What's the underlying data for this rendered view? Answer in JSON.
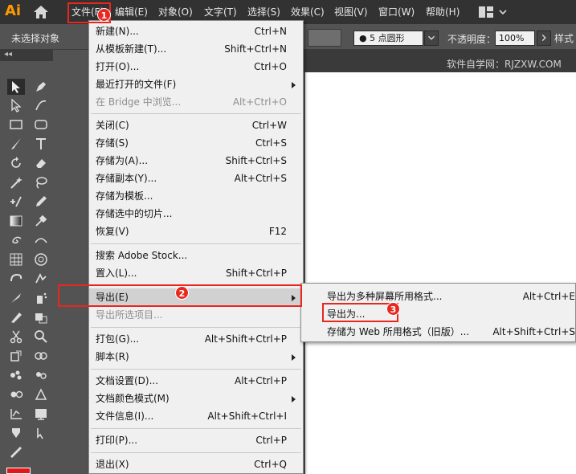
{
  "app": {
    "logo_text": "Ai"
  },
  "menubar": {
    "items": [
      "文件(F)",
      "编辑(E)",
      "对象(O)",
      "文字(T)",
      "选择(S)",
      "效果(C)",
      "视图(V)",
      "窗口(W)",
      "帮助(H)"
    ]
  },
  "controlbar": {
    "selection_status": "未选择对象",
    "brush_label": "5 点圆形",
    "opacity_label": "不透明度：",
    "opacity_value": "100%",
    "style_label": "样式"
  },
  "document": {
    "watermark": "软件自学网：RJZXW.COM"
  },
  "file_menu": {
    "items": [
      {
        "label": "新建(N)...",
        "shortcut": "Ctrl+N"
      },
      {
        "label": "从模板新建(T)...",
        "shortcut": "Shift+Ctrl+N"
      },
      {
        "label": "打开(O)...",
        "shortcut": "Ctrl+O"
      },
      {
        "label": "最近打开的文件(F)",
        "shortcut": ""
      },
      {
        "label": "在 Bridge 中浏览...",
        "shortcut": "Alt+Ctrl+O"
      },
      {
        "label": "关闭(C)",
        "shortcut": "Ctrl+W"
      },
      {
        "label": "存储(S)",
        "shortcut": "Ctrl+S"
      },
      {
        "label": "存储为(A)...",
        "shortcut": "Shift+Ctrl+S"
      },
      {
        "label": "存储副本(Y)...",
        "shortcut": "Alt+Ctrl+S"
      },
      {
        "label": "存储为模板...",
        "shortcut": ""
      },
      {
        "label": "存储选中的切片...",
        "shortcut": ""
      },
      {
        "label": "恢复(V)",
        "shortcut": "F12"
      },
      {
        "label": "搜索 Adobe Stock...",
        "shortcut": ""
      },
      {
        "label": "置入(L)...",
        "shortcut": "Shift+Ctrl+P"
      },
      {
        "label": "导出(E)",
        "shortcut": ""
      },
      {
        "label": "导出所选项目...",
        "shortcut": ""
      },
      {
        "label": "打包(G)...",
        "shortcut": "Alt+Shift+Ctrl+P"
      },
      {
        "label": "脚本(R)",
        "shortcut": ""
      },
      {
        "label": "文档设置(D)...",
        "shortcut": "Alt+Ctrl+P"
      },
      {
        "label": "文档颜色模式(M)",
        "shortcut": ""
      },
      {
        "label": "文件信息(I)...",
        "shortcut": "Alt+Shift+Ctrl+I"
      },
      {
        "label": "打印(P)...",
        "shortcut": "Ctrl+P"
      },
      {
        "label": "退出(X)",
        "shortcut": "Ctrl+Q"
      }
    ]
  },
  "export_submenu": {
    "items": [
      {
        "label": "导出为多种屏幕所用格式...",
        "shortcut": "Alt+Ctrl+E"
      },
      {
        "label": "导出为...",
        "shortcut": ""
      },
      {
        "label": "存储为 Web 所用格式（旧版）...",
        "shortcut": "Alt+Shift+Ctrl+S"
      }
    ]
  },
  "annotations": {
    "badge_1": "1",
    "badge_2": "2",
    "badge_3": "3"
  },
  "colors": {
    "annotation_red": "#e8271f",
    "logo_orange": "#ff9a00",
    "fill_swatch": "#e01818"
  }
}
